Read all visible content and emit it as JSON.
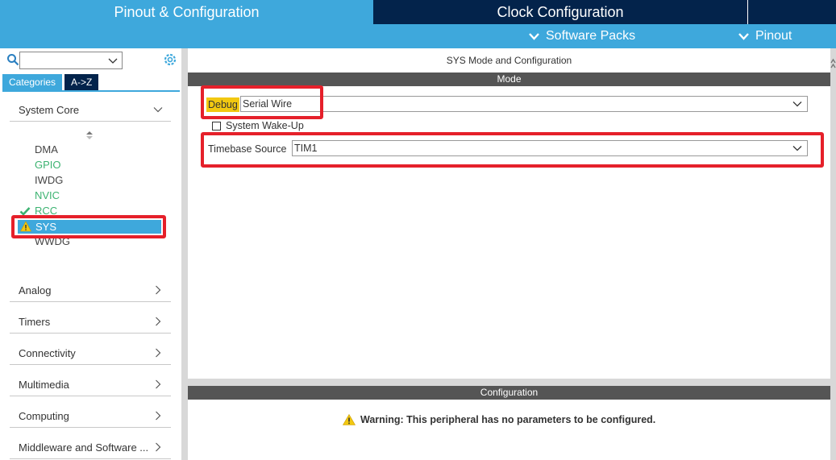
{
  "tabs": {
    "pinout": "Pinout & Configuration",
    "clock": "Clock Configuration"
  },
  "submenu": {
    "software_packs": "Software Packs",
    "pinout": "Pinout"
  },
  "sidebar": {
    "search_value": "",
    "tab_categories": "Categories",
    "tab_az": "A->Z",
    "system_core": "System Core",
    "peripherals": [
      {
        "label": "DMA",
        "status": "normal"
      },
      {
        "label": "GPIO",
        "status": "green"
      },
      {
        "label": "IWDG",
        "status": "normal"
      },
      {
        "label": "NVIC",
        "status": "green"
      },
      {
        "label": "RCC",
        "status": "green-check"
      },
      {
        "label": "SYS",
        "status": "warning-selected"
      },
      {
        "label": "WWDG",
        "status": "normal"
      }
    ],
    "categories": [
      "Analog",
      "Timers",
      "Connectivity",
      "Multimedia",
      "Computing",
      "Middleware and Software ..."
    ]
  },
  "main": {
    "title": "SYS Mode and Configuration",
    "mode_header": "Mode",
    "debug_label": "Debug",
    "debug_value": "Serial Wire",
    "wakeup_label": "System Wake-Up",
    "timebase_label": "Timebase Source",
    "timebase_value": "TIM1",
    "config_header": "Configuration",
    "warning_text": "Warning: This peripheral has no parameters to be configured."
  },
  "colors": {
    "accent": "#3ea8dc",
    "navy": "#03234b",
    "highlight_red": "#e5202a",
    "green": "#3cb371",
    "debug_yellow": "#f2c811"
  }
}
